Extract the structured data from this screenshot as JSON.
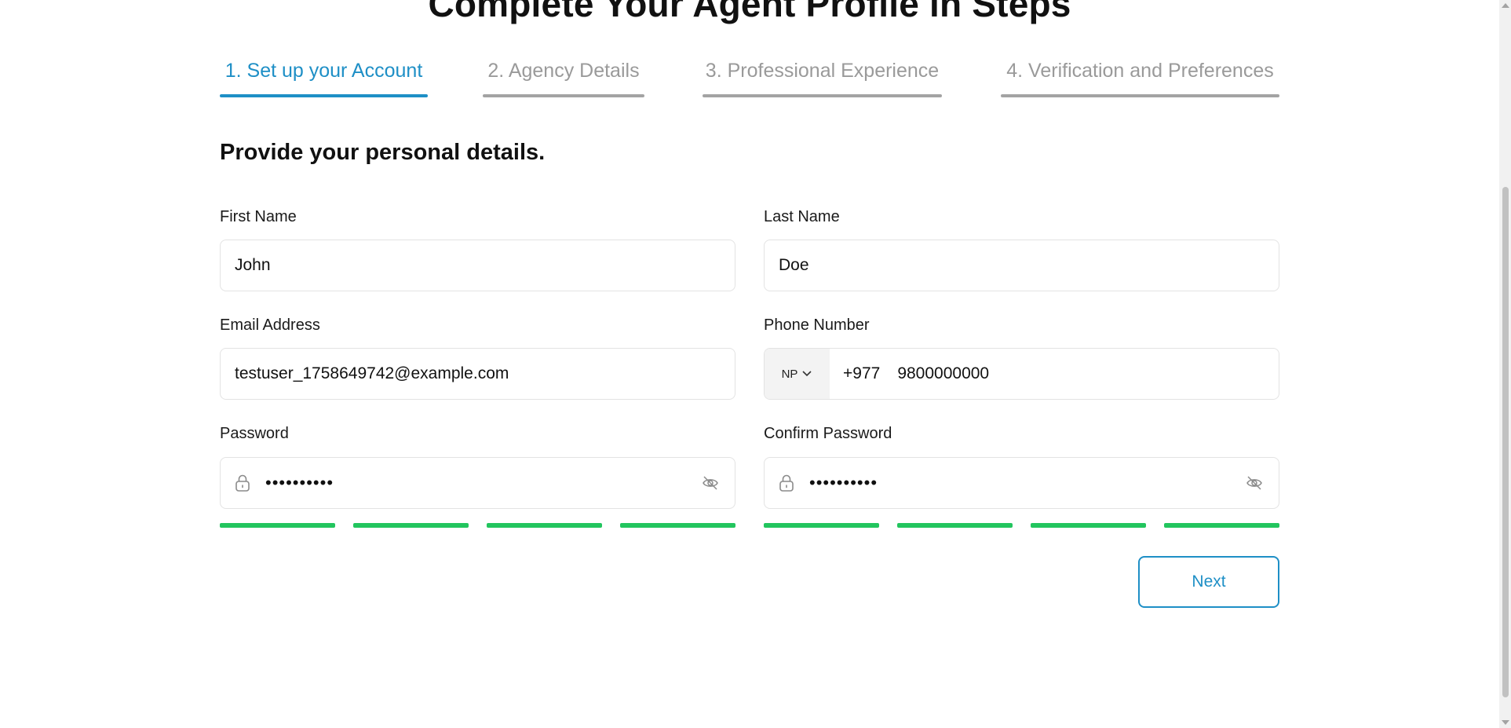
{
  "page": {
    "title": "Complete Your Agent Profile in Steps"
  },
  "steps": [
    {
      "label": "1. Set up your Account",
      "active": true
    },
    {
      "label": "2. Agency Details",
      "active": false
    },
    {
      "label": "3. Professional Experience",
      "active": false
    },
    {
      "label": "4. Verification and Preferences",
      "active": false
    }
  ],
  "form": {
    "heading": "Provide your personal details.",
    "first_name": {
      "label": "First Name",
      "value": "John"
    },
    "last_name": {
      "label": "Last Name",
      "value": "Doe"
    },
    "email": {
      "label": "Email Address",
      "value": "testuser_1758649742@example.com"
    },
    "phone": {
      "label": "Phone Number",
      "country": "NP",
      "dial_code": "+977",
      "value": "9800000000"
    },
    "password": {
      "label": "Password",
      "value": "••••••••••",
      "strength_filled": 4,
      "strength_total": 4
    },
    "confirm_password": {
      "label": "Confirm Password",
      "value": "••••••••••",
      "strength_filled": 4,
      "strength_total": 4
    },
    "next_label": "Next"
  },
  "colors": {
    "accent": "#1e8fc6",
    "inactive_step": "#a3a3a3",
    "strength": "#22c55e"
  },
  "icons": {
    "lock": "lock-icon",
    "eye_off": "eye-off-icon",
    "chevron": "chevron-down-icon"
  }
}
